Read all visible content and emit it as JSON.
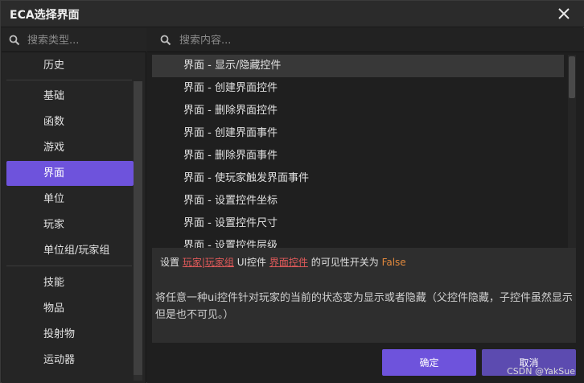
{
  "window": {
    "title": "ECA选择界面"
  },
  "left": {
    "search_placeholder": "搜索类型...",
    "categories": [
      "历史",
      "基础",
      "函数",
      "游戏",
      "界面",
      "单位",
      "玩家",
      "单位组/玩家组",
      "技能",
      "物品",
      "投射物",
      "运动器"
    ],
    "active_category": "界面"
  },
  "right": {
    "search_placeholder": "搜索内容...",
    "items": [
      "界面 - 显示/隐藏控件",
      "界面 - 创建界面控件",
      "界面 - 删除界面控件",
      "界面 - 创建界面事件",
      "界面 - 删除界面事件",
      "界面 - 使玩家触发界面事件",
      "界面 - 设置控件坐标",
      "界面 - 设置控件尺寸",
      "界面 - 设置控件层级"
    ],
    "selected_item": "界面 - 显示/隐藏控件"
  },
  "description": {
    "prefix": "设置",
    "link1": "玩家|玩家组",
    "mid1": "UI控件",
    "link2": "界面控件",
    "mid2": "的可见性开关为",
    "value": "False",
    "body": "将任意一种ui控件针对玩家的当前的状态变为显示或者隐藏（父控件隐藏，子控件虽然显示但是也不可见。）"
  },
  "buttons": {
    "ok": "确定",
    "cancel": "取消"
  },
  "watermark": "CSDN @YakSue"
}
